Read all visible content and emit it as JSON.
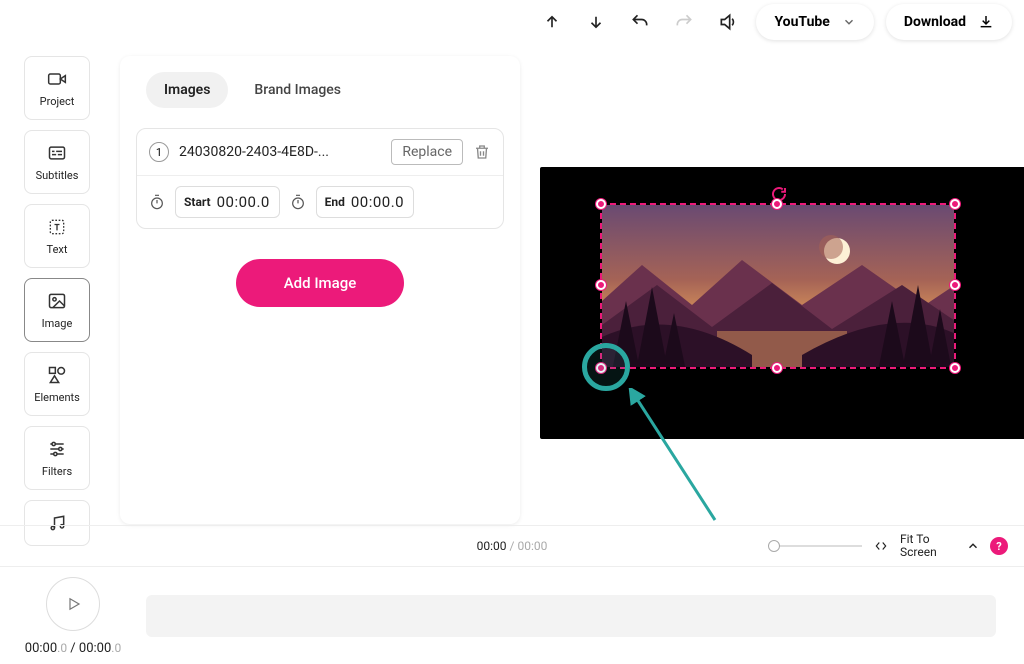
{
  "topbar": {
    "platform_label": "YouTube",
    "download_label": "Download"
  },
  "sidebar": {
    "items": [
      {
        "label": "Project"
      },
      {
        "label": "Subtitles"
      },
      {
        "label": "Text"
      },
      {
        "label": "Image"
      },
      {
        "label": "Elements"
      },
      {
        "label": "Filters"
      },
      {
        "label": ""
      }
    ]
  },
  "panel": {
    "tabs": {
      "images": "Images",
      "brand_images": "Brand Images"
    },
    "image": {
      "index": "1",
      "filename": "24030820-2403-4E8D-...",
      "replace_label": "Replace",
      "start_label": "Start",
      "start_value": "00:00.0",
      "end_label": "End",
      "end_value": "00:00.0"
    },
    "add_image_label": "Add Image"
  },
  "status": {
    "current": "00:00",
    "separator": " / ",
    "duration": "00:00",
    "fit_label": "Fit To Screen",
    "help": "?"
  },
  "timeline": {
    "play_current": "00:00",
    "play_current_ms": ".0",
    "play_sep": " / ",
    "play_total": "00:00",
    "play_total_ms": ".0"
  }
}
